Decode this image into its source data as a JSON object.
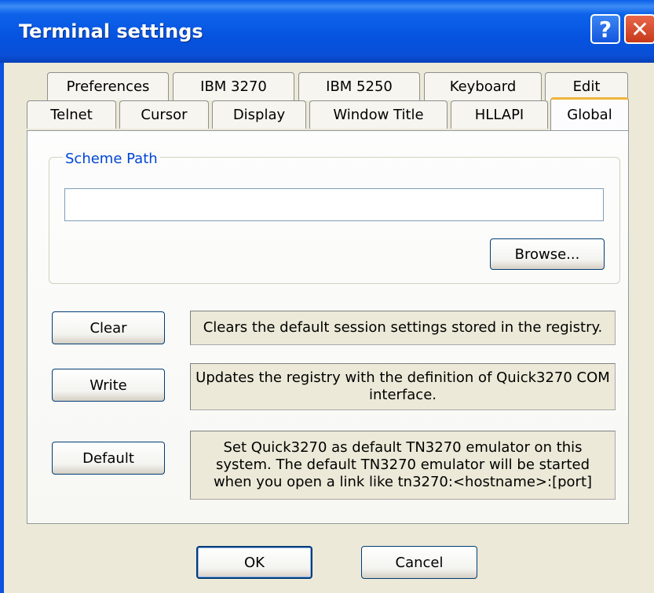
{
  "window": {
    "title": "Terminal settings"
  },
  "titlebar_icons": {
    "help": "?",
    "close": "✕"
  },
  "tabs_back": [
    "Preferences",
    "IBM 3270",
    "IBM 5250",
    "Keyboard",
    "Edit"
  ],
  "tabs_front": [
    "Telnet",
    "Cursor",
    "Display",
    "Window Title",
    "HLLAPI",
    "Global"
  ],
  "active_tab": "Global",
  "scheme_path": {
    "legend": "Scheme Path",
    "value": "",
    "browse_label": "Browse..."
  },
  "actions": [
    {
      "label": "Clear",
      "description": "Clears the default session settings stored in the registry."
    },
    {
      "label": "Write",
      "description": "Updates the registry with the definition of Quick3270 COM interface."
    },
    {
      "label": "Default",
      "description": "Set Quick3270 as default TN3270 emulator on this system. The default TN3270 emulator will be started when you open a link like tn3270:<hostname>:[port]"
    }
  ],
  "footer": {
    "ok_label": "OK",
    "cancel_label": "Cancel"
  }
}
